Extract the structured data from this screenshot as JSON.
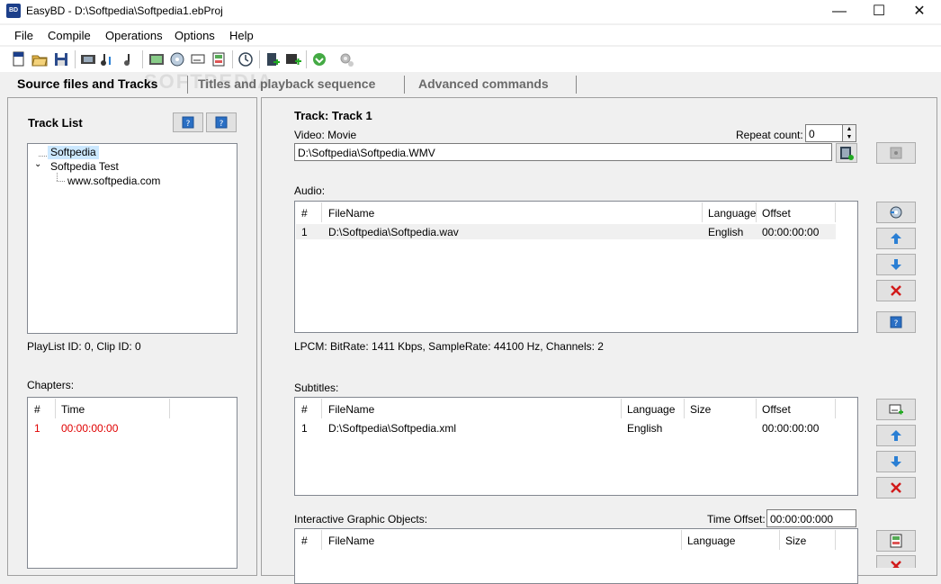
{
  "window": {
    "title": "EasyBD - D:\\Softpedia\\Softpedia1.ebProj",
    "icon_text": "BD",
    "minimize": "—",
    "maximize": "☐",
    "close": "✕"
  },
  "menu": [
    "File",
    "Compile",
    "Operations",
    "Options",
    "Help"
  ],
  "tabs": {
    "source": "Source files and Tracks",
    "titles": "Titles and playback sequence",
    "advanced": "Advanced commands"
  },
  "watermark": "SOFTPEDIA",
  "left": {
    "track_list_title": "Track List",
    "tree": [
      "Softpedia",
      "Softpedia Test",
      "www.softpedia.com"
    ],
    "playlist_info": "PlayList ID: 0, Clip ID: 0",
    "chapters_label": "Chapters:",
    "chapters_headers": [
      "#",
      "Time"
    ],
    "chapters_rows": [
      [
        "1",
        "00:00:00:00"
      ]
    ]
  },
  "track": {
    "title": "Track: Track 1",
    "video_label": "Video: Movie",
    "repeat_label": "Repeat count:",
    "repeat_value": "0",
    "video_path": "D:\\Softpedia\\Softpedia.WMV"
  },
  "audio": {
    "label": "Audio:",
    "headers": [
      "#",
      "FileName",
      "Language",
      "Offset"
    ],
    "rows": [
      [
        "1",
        "D:\\Softpedia\\Softpedia.wav",
        "English",
        "00:00:00:00"
      ]
    ],
    "info": "LPCM: BitRate: 1411 Kbps, SampleRate: 44100 Hz, Channels: 2"
  },
  "subtitles": {
    "label": "Subtitles:",
    "headers": [
      "#",
      "FileName",
      "Language",
      "Size",
      "Offset"
    ],
    "rows": [
      [
        "1",
        "D:\\Softpedia\\Softpedia.xml",
        "English",
        "",
        "00:00:00:00"
      ]
    ]
  },
  "igo": {
    "label": "Interactive Graphic Objects:",
    "time_offset_label": "Time Offset:",
    "time_offset_value": "00:00:00:000",
    "headers": [
      "#",
      "FileName",
      "Language",
      "Size"
    ]
  },
  "colors": {
    "chapter_row": "#e00000",
    "up_arrow": "#2a7fd4",
    "delete": "#d11a1a",
    "tree_selected": "#cce8ff"
  }
}
